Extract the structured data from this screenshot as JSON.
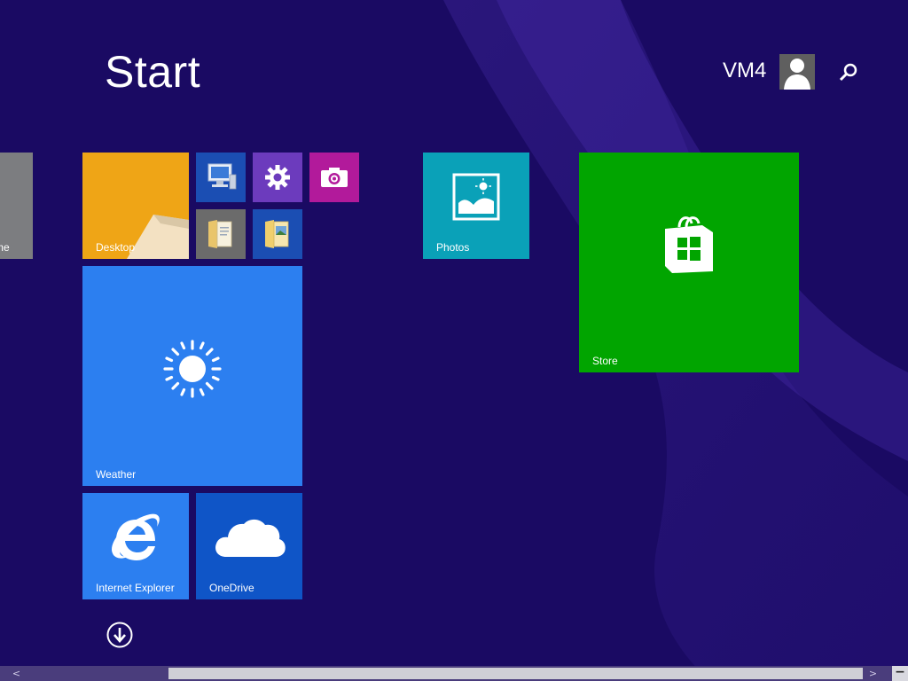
{
  "screen": {
    "title": "Start",
    "background_color": "#1a0a63"
  },
  "user": {
    "name": "VM4",
    "avatar_icon": "user-silhouette-icon"
  },
  "search": {
    "icon": "search-icon"
  },
  "tiles": {
    "partial": {
      "label": "me",
      "color": "#7c7d80"
    },
    "desktop": {
      "label": "Desktop",
      "color": "#efa516"
    },
    "this_pc": {
      "icon": "computer-icon",
      "color": "#1b4eb3"
    },
    "pc_settings": {
      "icon": "gear-icon",
      "color": "#6c3bbd"
    },
    "camera": {
      "icon": "camera-icon",
      "color": "#b21a9b"
    },
    "documents": {
      "icon": "document-folder-icon",
      "color": "#6b6b6b"
    },
    "file_explorer": {
      "icon": "folder-icon",
      "color": "#1b4eb3"
    },
    "photos": {
      "label": "Photos",
      "icon": "photo-icon",
      "color": "#0aa1b8"
    },
    "store": {
      "label": "Store",
      "icon": "store-bag-icon",
      "color": "#01a500"
    },
    "weather": {
      "label": "Weather",
      "icon": "sun-icon",
      "color": "#2c7ff0"
    },
    "internet_explorer": {
      "label": "Internet Explorer",
      "icon": "ie-logo-icon",
      "color": "#2c7ff0"
    },
    "onedrive": {
      "label": "OneDrive",
      "icon": "cloud-icon",
      "color": "#0f55c7"
    }
  },
  "all_apps": {
    "icon": "down-arrow-circle-icon"
  },
  "scrollbar": {
    "left_arrow": "<",
    "right_arrow": ">",
    "zoom_out_label": "−"
  }
}
